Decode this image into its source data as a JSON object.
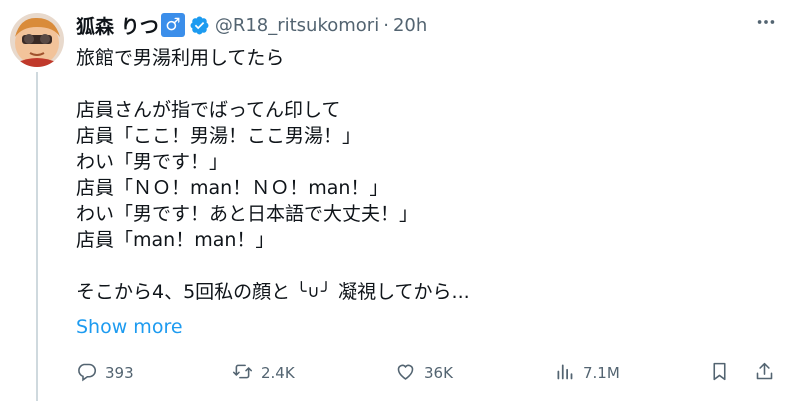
{
  "tweet": {
    "display_name": "狐森 りつ",
    "gender_symbol": "♂",
    "handle": "@R18_ritsukomori",
    "separator": "·",
    "time": "20h",
    "lines": [
      "旅館で男湯利用してたら",
      "",
      "店員さんが指でばってん印して",
      "店員「ここ！男湯！ここ男湯！」",
      "わい「男です！」",
      "店員「ＮＯ！man！ＮＯ！man！」",
      "わい「男です！あと日本語で大丈夫！」",
      "店員「man！man！」",
      ""
    ],
    "last_line_before": "そこから4、5回私の顔と",
    "kaomoji": "╰∪╯",
    "last_line_after": "凝視してから...",
    "show_more": "Show more"
  },
  "actions": {
    "replies": "393",
    "reposts": "2.4K",
    "likes": "36K",
    "views": "7.1M"
  },
  "icons": [
    "more-icon",
    "verified-icon",
    "reply-icon",
    "repost-icon",
    "like-icon",
    "views-icon",
    "bookmark-icon",
    "share-icon"
  ],
  "colors": {
    "accent": "#1d9bf0",
    "text": "#0f1419",
    "muted": "#536471",
    "badge": "#3b8eea"
  }
}
